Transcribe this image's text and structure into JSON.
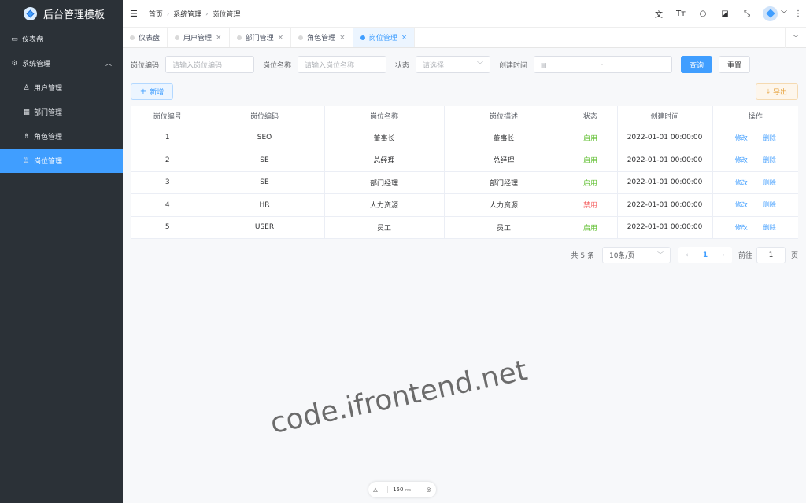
{
  "app": {
    "title": "后台管理模板"
  },
  "sidebar": {
    "items": [
      {
        "label": "仪表盘",
        "icon": "monitor-icon"
      },
      {
        "label": "系统管理",
        "icon": "gear-icon"
      },
      {
        "label": "用户管理",
        "icon": "user-icon"
      },
      {
        "label": "部门管理",
        "icon": "org-icon"
      },
      {
        "label": "角色管理",
        "icon": "role-icon"
      },
      {
        "label": "岗位管理",
        "icon": "post-icon"
      }
    ]
  },
  "header": {
    "breadcrumb": [
      "首页",
      "系统管理",
      "岗位管理"
    ]
  },
  "tabs": [
    {
      "label": "仪表盘"
    },
    {
      "label": "用户管理"
    },
    {
      "label": "部门管理"
    },
    {
      "label": "角色管理"
    },
    {
      "label": "岗位管理"
    }
  ],
  "search": {
    "code_label": "岗位编码",
    "code_placeholder": "请输入岗位编码",
    "name_label": "岗位名称",
    "name_placeholder": "请输入岗位名称",
    "status_label": "状态",
    "status_placeholder": "请选择",
    "time_label": "创建时间",
    "time_sep": "-",
    "query": "查询",
    "reset": "重置"
  },
  "toolbar": {
    "add": "新增",
    "export": "导出"
  },
  "table": {
    "headers": [
      "岗位编号",
      "岗位编码",
      "岗位名称",
      "岗位描述",
      "状态",
      "创建时间",
      "操作"
    ],
    "rows": [
      {
        "id": "1",
        "code": "SEO",
        "name": "董事长",
        "desc": "董事长",
        "status": "启用",
        "time": "2022-01-01 00:00:00",
        "edit": "修改",
        "del": "删除"
      },
      {
        "id": "2",
        "code": "SE",
        "name": "总经理",
        "desc": "总经理",
        "status": "启用",
        "time": "2022-01-01 00:00:00",
        "edit": "修改",
        "del": "删除"
      },
      {
        "id": "3",
        "code": "SE",
        "name": "部门经理",
        "desc": "部门经理",
        "status": "启用",
        "time": "2022-01-01 00:00:00",
        "edit": "修改",
        "del": "删除"
      },
      {
        "id": "4",
        "code": "HR",
        "name": "人力资源",
        "desc": "人力资源",
        "status": "禁用",
        "time": "2022-01-01 00:00:00",
        "edit": "修改",
        "del": "删除"
      },
      {
        "id": "5",
        "code": "USER",
        "name": "员工",
        "desc": "员工",
        "status": "启用",
        "time": "2022-01-01 00:00:00",
        "edit": "修改",
        "del": "删除"
      }
    ]
  },
  "pagination": {
    "total": "共 5 条",
    "size": "10条/页",
    "page": "1",
    "goto": "前往",
    "goto_value": "1",
    "unit": "页"
  },
  "watermark": "code.ifrontend.net",
  "perf": {
    "value": "150",
    "unit": "ms"
  },
  "colors": {
    "primary": "#409eff",
    "sidebar": "#2b3137",
    "success": "#67c23a",
    "danger": "#f56c6c",
    "warning": "#e6a23c"
  }
}
